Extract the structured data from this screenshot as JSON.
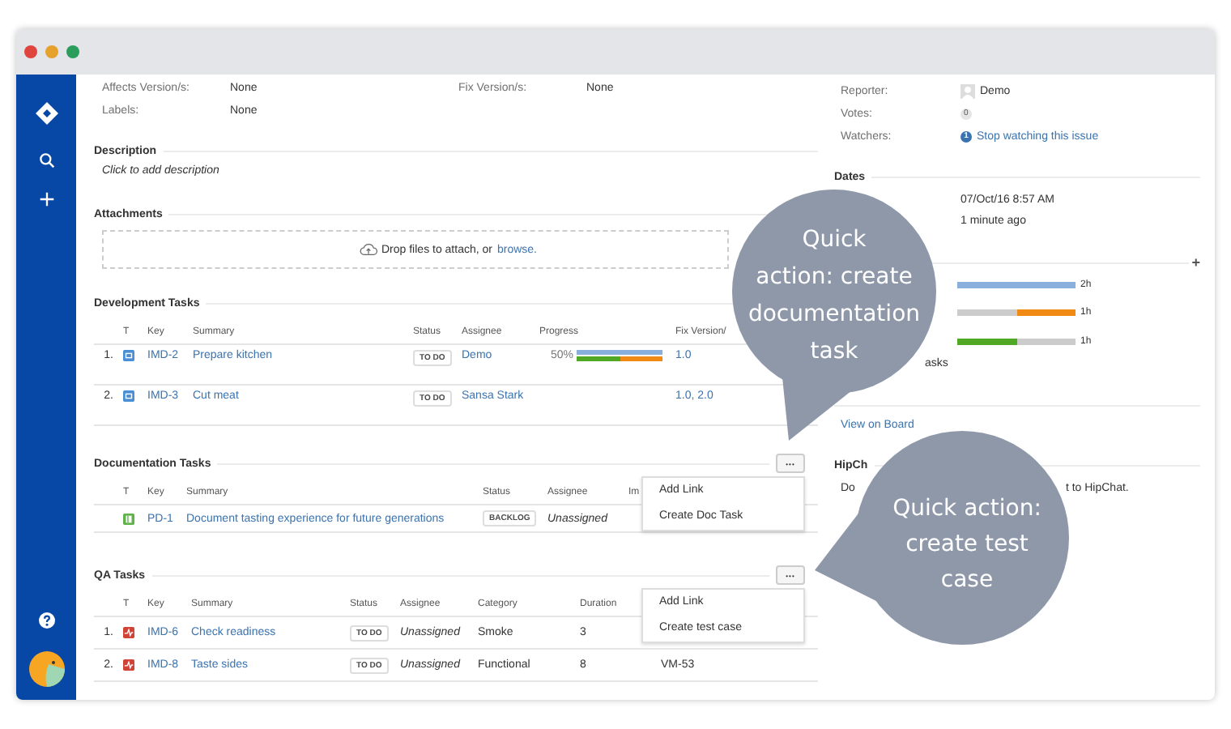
{
  "details": {
    "fields": [
      {
        "label": "Affects Version/s:",
        "value": "None"
      },
      {
        "label": "Fix Version/s:",
        "value": "None"
      },
      {
        "label": "Labels:",
        "value": "None"
      }
    ]
  },
  "description": {
    "title": "Description",
    "text": "Click to add description"
  },
  "attachments": {
    "title": "Attachments",
    "text": "Drop files to attach, or",
    "link": "browse."
  },
  "dev_tasks": {
    "title": "Development Tasks",
    "columns": [
      "T",
      "Key",
      "Summary",
      "Status",
      "Assignee",
      "Progress",
      "Fix Version/"
    ],
    "rows": [
      {
        "number": "1.",
        "kind": "task",
        "key": "IMD-2",
        "summary": "Prepare kitchen",
        "status": "TO DO",
        "assignee": "Demo",
        "progress": "50%",
        "level": 0.5,
        "fix_version": "1.0"
      },
      {
        "number": "2.",
        "kind": "task",
        "key": "IMD-3",
        "summary": "Cut meat",
        "status": "TO DO",
        "assignee": "Sansa Stark",
        "fix_version": "1.0, 2.0"
      }
    ]
  },
  "doc_tasks": {
    "title": "Documentation Tasks",
    "more": "•••",
    "columns": [
      "T",
      "Key",
      "Summary",
      "Status",
      "Assignee",
      "Im"
    ],
    "rows": [
      {
        "kind": "doc",
        "key": "PD-1",
        "summary": "Document tasting experience for future generations",
        "status": "BACKLOG",
        "assignee": "Unassigned"
      }
    ],
    "menu": [
      "Add Link",
      "Create Doc Task"
    ]
  },
  "qa_tasks": {
    "title": "QA Tasks",
    "more": "•••",
    "columns": [
      "T",
      "Key",
      "Summary",
      "Status",
      "Assignee",
      "Category",
      "Duration"
    ],
    "rows": [
      {
        "number": "1.",
        "kind": "test",
        "key": "IMD-6",
        "summary": "Check readiness",
        "status": "TO DO",
        "assignee": "Unassigned",
        "category": "Smoke",
        "duration": "3"
      },
      {
        "number": "2.",
        "kind": "test",
        "key": "IMD-8",
        "summary": "Taste sides",
        "status": "TO DO",
        "assignee": "Unassigned",
        "category": "Functional",
        "duration": "8",
        "column_8": "VM-53"
      }
    ],
    "menu": [
      "Add Link",
      "Create test case"
    ]
  },
  "people": {
    "fields": [
      {
        "label": "Reporter:",
        "kind": "avatar",
        "value": "Demo"
      },
      {
        "label": "Votes:",
        "kind": "count",
        "value": "0"
      },
      {
        "label": "Watchers:",
        "kind": "link",
        "count": "1",
        "value": "Stop watching this issue"
      }
    ]
  },
  "dates": {
    "title": "Dates",
    "values": [
      "07/Oct/16 8:57 AM",
      "1 minute ago"
    ]
  },
  "time_tracking": {
    "add": "+",
    "bars": [
      {
        "kind": "estimated",
        "level": 1,
        "reading": "2h"
      },
      {
        "kind": "remaining",
        "level": 0.5,
        "reading": "1h"
      },
      {
        "kind": "logged",
        "level": 0.5,
        "reading": "1h"
      }
    ],
    "note": "asks"
  },
  "agile": {
    "link": "View on Board"
  },
  "hipchat": {
    "title": "HipCh",
    "text_start": "Do",
    "text_end": "t to HipChat."
  },
  "callouts": [
    {
      "text": "Quick\naction: create\ndocumentation\ntask"
    },
    {
      "text": "Quick action:\ncreate test\ncase"
    }
  ]
}
